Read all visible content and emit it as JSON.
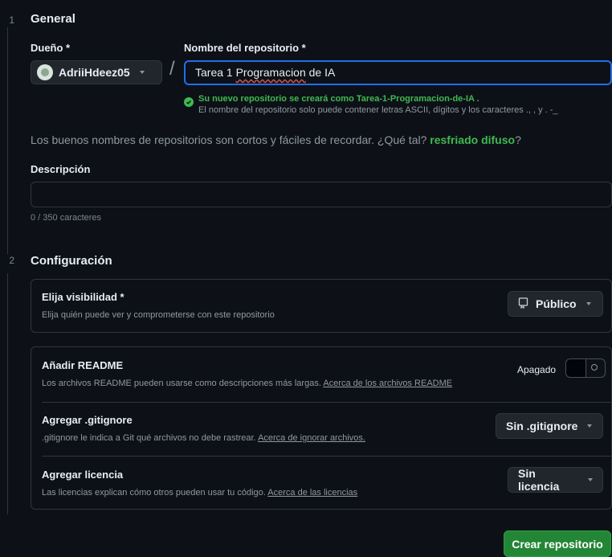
{
  "steps": [
    "1",
    "2"
  ],
  "general": {
    "title": "General",
    "owner_label": "Dueño *",
    "owner_name": "AdriiHdeez05",
    "repo_label": "Nombre del repositorio *",
    "repo_value_prefix": "Tarea 1 ",
    "repo_value_misspelled": "Programacion",
    "repo_value_suffix": " de IA",
    "ok_message": "Su nuevo repositorio se creará como Tarea-1-Programacion-de-IA .",
    "ascii_hint": "El nombre del repositorio solo puede contener letras ASCII, dígitos y los caracteres  ., , y . -_",
    "tagline_prefix": "Los buenos nombres de repositorios son cortos y fáciles de recordar. ¿Qué tal? ",
    "tagline_suggestion": "resfriado difuso",
    "tagline_suffix": "?",
    "description_label": "Descripción",
    "description_value": "",
    "char_counter": "0 / 350 caracteres"
  },
  "config": {
    "title": "Configuración",
    "visibility": {
      "title": "Elija visibilidad *",
      "desc": "Elija quién puede ver y comprometerse con este repositorio",
      "value": "Público",
      "icon": "repo-icon"
    },
    "readme": {
      "title": "Añadir README",
      "desc": "Los archivos README pueden usarse como descripciones más largas. ",
      "link": "Acerca de los archivos README",
      "toggle_label": "Apagado",
      "toggle_on": false
    },
    "gitignore": {
      "title": "Agregar .gitignore",
      "desc": ".gitignore le indica a Git qué archivos no debe rastrear. ",
      "link": "Acerca de ignorar archivos.",
      "value": "Sin .gitignore"
    },
    "license": {
      "title": "Agregar licencia",
      "desc": "Las licencias explican cómo otros pueden usar tu código. ",
      "link": "Acerca de las licencias",
      "value": "Sin licencia"
    }
  },
  "create_button": "Crear repositorio",
  "colors": {
    "background": "#0d1117",
    "accent_green": "#238636",
    "success_text": "#3fb950",
    "focus_blue": "#1f6feb"
  }
}
